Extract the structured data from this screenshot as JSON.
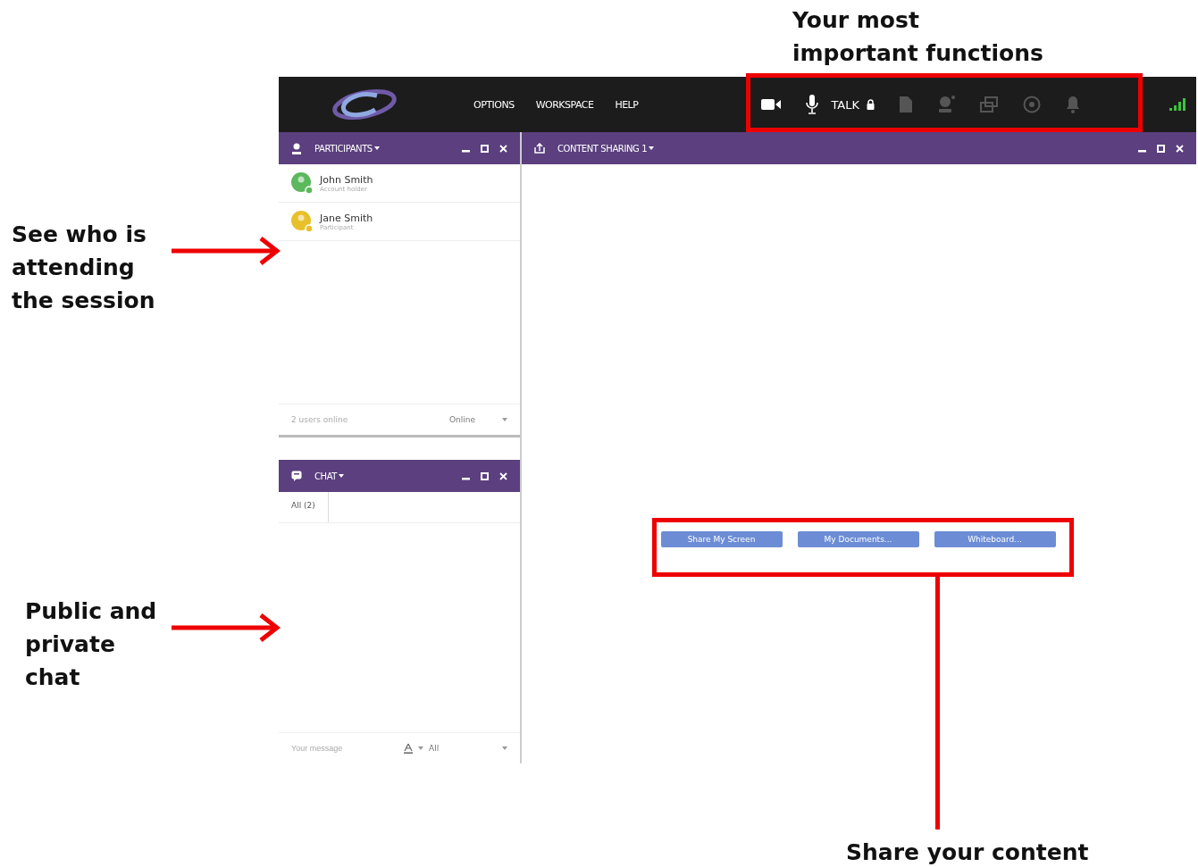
{
  "menu": [
    "OPTIONS",
    "WORKSPACE",
    "HELP"
  ],
  "toolbar": [
    {
      "kind": "video",
      "disabled": false
    },
    {
      "kind": "mic",
      "disabled": false
    },
    {
      "kind": "talk",
      "label": "TALK",
      "disabled": false
    },
    {
      "kind": "document",
      "disabled": true
    },
    {
      "kind": "person",
      "disabled": true
    },
    {
      "kind": "windows",
      "disabled": true
    },
    {
      "kind": "record",
      "disabled": true
    },
    {
      "kind": "bell",
      "disabled": true
    }
  ],
  "participants_panel": {
    "title": "PARTICIPANTS",
    "people": [
      {
        "name": "John Smith",
        "role": "Account holder",
        "color": "#5cb85c"
      },
      {
        "name": "Jane Smith",
        "role": "Participant",
        "color": "#e8c02a"
      }
    ],
    "status_text": "2 users online",
    "status_select": "Online"
  },
  "chat_panel": {
    "title": "CHAT",
    "tabs": [
      {
        "label": "All (2)",
        "selected": true
      }
    ],
    "placeholder": "Your message",
    "recipient": "All"
  },
  "content_panel": {
    "title": "CONTENT SHARING 1",
    "buttons": [
      "Share My Screen",
      "My Documents...",
      "Whiteboard..."
    ]
  },
  "callouts": {
    "functions": "Your most important functions",
    "participants": "See who is attending the session",
    "chat": "Public and private chat",
    "share": "Share your content"
  }
}
